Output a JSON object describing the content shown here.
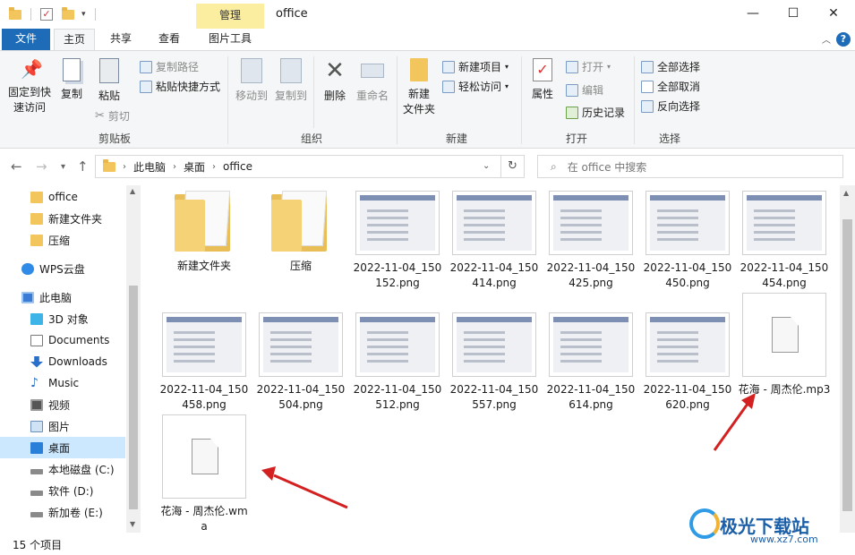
{
  "window": {
    "title": "office",
    "context_tab": "管理",
    "controls": {
      "minimize": "—",
      "maximize": "☐",
      "close": "✕"
    }
  },
  "tabs": [
    {
      "label": "文件"
    },
    {
      "label": "主页"
    },
    {
      "label": "共享"
    },
    {
      "label": "查看"
    },
    {
      "label": "图片工具"
    }
  ],
  "ribbon": {
    "clipboard": {
      "label": "剪贴板",
      "pin_line1": "固定到快",
      "pin_line2": "速访问",
      "copy": "复制",
      "paste": "粘贴",
      "copy_path": "复制路径",
      "paste_shortcut": "粘贴快捷方式",
      "cut": "剪切"
    },
    "organize": {
      "label": "组织",
      "move_to": "移动到",
      "copy_to": "复制到",
      "delete": "删除",
      "rename": "重命名"
    },
    "new": {
      "label": "新建",
      "new_folder_line1": "新建",
      "new_folder_line2": "文件夹",
      "new_item": "新建项目",
      "easy_access": "轻松访问"
    },
    "open": {
      "label": "打开",
      "properties": "属性",
      "open": "打开",
      "edit": "编辑",
      "history": "历史记录"
    },
    "select": {
      "label": "选择",
      "select_all": "全部选择",
      "select_none": "全部取消",
      "invert": "反向选择"
    }
  },
  "address": {
    "crumbs": [
      "此电脑",
      "桌面",
      "office"
    ],
    "search_placeholder": "在 office 中搜索"
  },
  "sidebar": {
    "items": [
      {
        "label": "office",
        "icon": "folder-icon"
      },
      {
        "label": "新建文件夹",
        "icon": "folder-icon"
      },
      {
        "label": "压缩",
        "icon": "folder-icon"
      },
      {
        "label": "WPS云盘",
        "icon": "cloud-icon"
      },
      {
        "label": "此电脑",
        "icon": "computer-icon"
      },
      {
        "label": "3D 对象",
        "icon": "cube-icon"
      },
      {
        "label": "Documents",
        "icon": "document-icon"
      },
      {
        "label": "Downloads",
        "icon": "download-icon"
      },
      {
        "label": "Music",
        "icon": "music-icon"
      },
      {
        "label": "视频",
        "icon": "video-icon"
      },
      {
        "label": "图片",
        "icon": "picture-icon"
      },
      {
        "label": "桌面",
        "icon": "desktop-icon"
      },
      {
        "label": "本地磁盘 (C:)",
        "icon": "drive-icon"
      },
      {
        "label": "软件 (D:)",
        "icon": "drive-icon"
      },
      {
        "label": "新加卷 (E:)",
        "icon": "drive-icon"
      }
    ]
  },
  "files": [
    {
      "name": "新建文件夹",
      "type": "folder"
    },
    {
      "name": "压缩",
      "type": "folder"
    },
    {
      "name": "2022-11-04_150152.png",
      "type": "image"
    },
    {
      "name": "2022-11-04_150414.png",
      "type": "image"
    },
    {
      "name": "2022-11-04_150425.png",
      "type": "image"
    },
    {
      "name": "2022-11-04_150450.png",
      "type": "image"
    },
    {
      "name": "2022-11-04_150454.png",
      "type": "image"
    },
    {
      "name": "2022-11-04_150458.png",
      "type": "image"
    },
    {
      "name": "2022-11-04_150504.png",
      "type": "image"
    },
    {
      "name": "2022-11-04_150512.png",
      "type": "image"
    },
    {
      "name": "2022-11-04_150557.png",
      "type": "image"
    },
    {
      "name": "2022-11-04_150614.png",
      "type": "image"
    },
    {
      "name": "2022-11-04_150620.png",
      "type": "image"
    },
    {
      "name": "花海 - 周杰伦.mp3",
      "type": "audio"
    },
    {
      "name": "花海 - 周杰伦.wma",
      "type": "audio"
    }
  ],
  "status": {
    "count": "15 个项目"
  },
  "watermark": {
    "text": "极光下载站",
    "url": "www.xz7.com"
  },
  "colors": {
    "file_tab": "#1e6bb8",
    "context_tab": "#fbeea0",
    "selection": "#cce8ff",
    "arrow": "#d32020"
  }
}
